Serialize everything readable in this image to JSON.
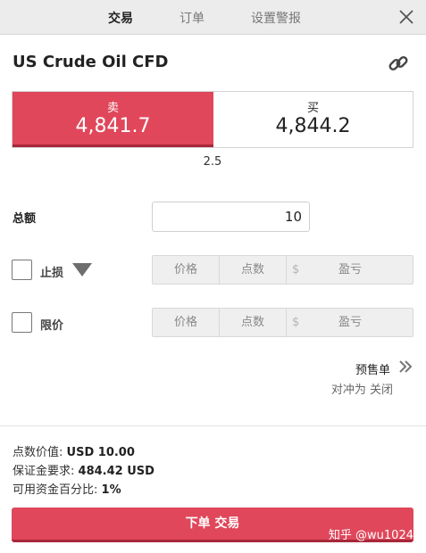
{
  "tabs": [
    {
      "label": "交易",
      "active": true
    },
    {
      "label": "订单",
      "active": false
    },
    {
      "label": "设置警报",
      "active": false
    }
  ],
  "icons": {
    "close": "close-icon",
    "link": "link-icon",
    "dropdown": "triangle-down-icon",
    "presale": "double-chevron-right-icon"
  },
  "instrument": {
    "title": "US Crude Oil CFD"
  },
  "quote": {
    "sell_label": "卖",
    "sell_price": "4,841.7",
    "buy_label": "买",
    "buy_price": "4,844.2",
    "spread": "2.5"
  },
  "amount": {
    "label": "总额",
    "value": "10"
  },
  "stop_loss": {
    "label": "止损",
    "checked": false,
    "price_placeholder": "价格",
    "points_placeholder": "点数",
    "currency_symbol": "$",
    "pl_placeholder": "盈亏"
  },
  "limit": {
    "label": "限价",
    "checked": false,
    "price_placeholder": "价格",
    "points_placeholder": "点数",
    "currency_symbol": "$",
    "pl_placeholder": "盈亏"
  },
  "presale": {
    "label": "预售单",
    "hedge_text": "对冲为 关闭"
  },
  "info": {
    "point_value_label": "点数价值:",
    "point_value": "USD 10.00",
    "margin_label": "保证金要求:",
    "margin": "484.42 USD",
    "funds_label": "可用资金百分比:",
    "funds_pct": "1%"
  },
  "submit": {
    "label": "下单 交易"
  },
  "watermark": "知乎 @wu1024",
  "colors": {
    "accent": "#e0475b",
    "accent_dark": "#a8273a",
    "topbar": "#ececec"
  }
}
